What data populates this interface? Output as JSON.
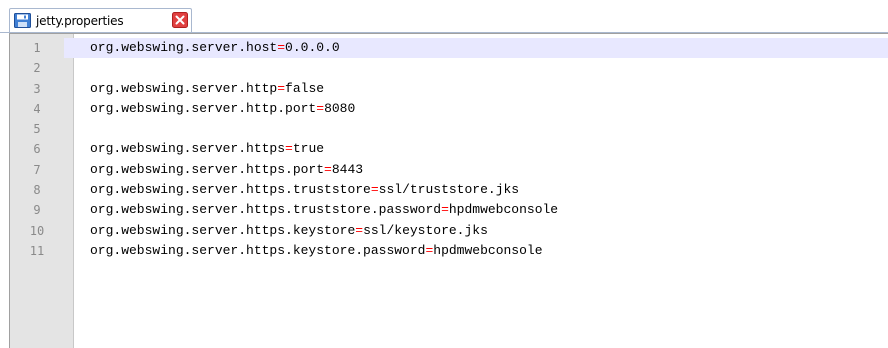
{
  "tab": {
    "label": "jetty.properties",
    "icon": "save-icon",
    "close_icon": "close-icon",
    "close_color": "#e04040"
  },
  "colors": {
    "gutter": "#e4e4e4",
    "current_line": "#e8e8ff",
    "equals": "#ff0000",
    "line_number": "#8a8a8a"
  },
  "lines": [
    {
      "num": "1",
      "key": "org.webswing.server.host",
      "eq": "=",
      "val": "0.0.0.0"
    },
    {
      "num": "2",
      "key": "",
      "eq": "",
      "val": ""
    },
    {
      "num": "3",
      "key": "org.webswing.server.http",
      "eq": "=",
      "val": "false"
    },
    {
      "num": "4",
      "key": "org.webswing.server.http.port",
      "eq": "=",
      "val": "8080"
    },
    {
      "num": "5",
      "key": "",
      "eq": "",
      "val": ""
    },
    {
      "num": "6",
      "key": "org.webswing.server.https",
      "eq": "=",
      "val": "true"
    },
    {
      "num": "7",
      "key": "org.webswing.server.https.port",
      "eq": "=",
      "val": "8443"
    },
    {
      "num": "8",
      "key": "org.webswing.server.https.truststore",
      "eq": "=",
      "val": "ssl/truststore.jks"
    },
    {
      "num": "9",
      "key": "org.webswing.server.https.truststore.password",
      "eq": "=",
      "val": "hpdmwebconsole"
    },
    {
      "num": "10",
      "key": "org.webswing.server.https.keystore",
      "eq": "=",
      "val": "ssl/keystore.jks"
    },
    {
      "num": "11",
      "key": "org.webswing.server.https.keystore.password",
      "eq": "=",
      "val": "hpdmwebconsole"
    }
  ]
}
